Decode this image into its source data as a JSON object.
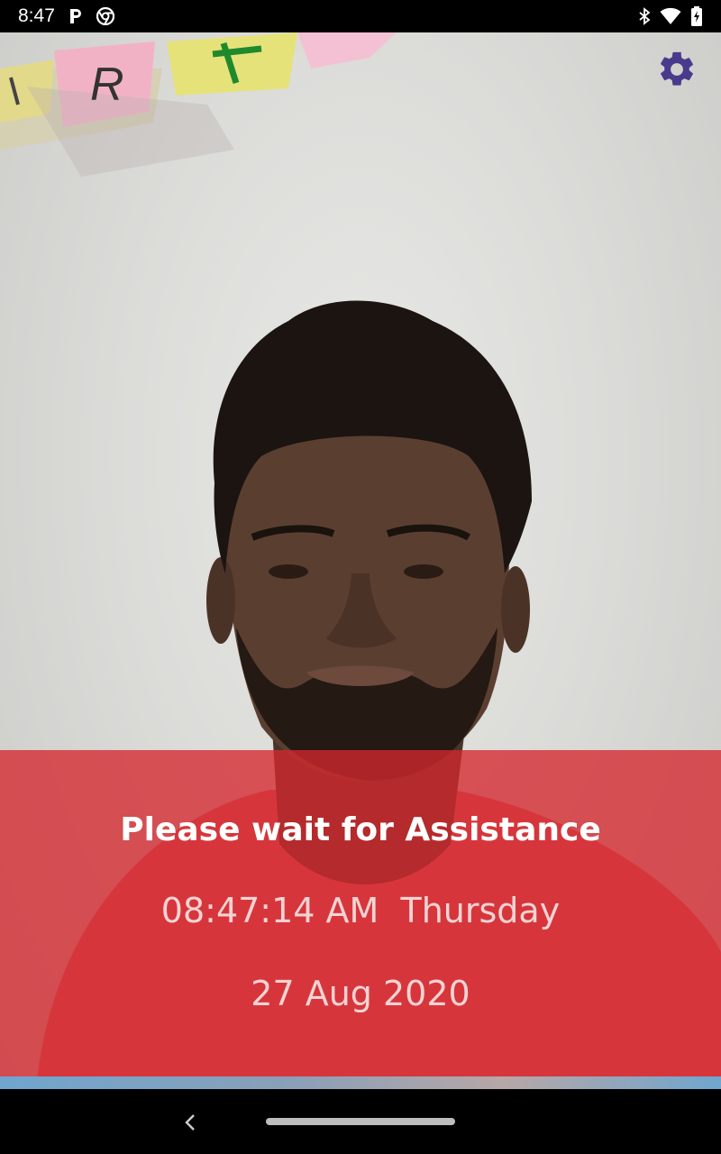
{
  "status_bar": {
    "time": "8:47",
    "left_icons": [
      "parking-p-icon",
      "chrome-icon"
    ],
    "right_icons": [
      "bluetooth-icon",
      "wifi-icon",
      "battery-charging-icon"
    ]
  },
  "camera": {
    "settings_icon": "gear-icon",
    "accent_color": "#4a3a8c"
  },
  "overlay": {
    "message": "Please wait for Assistance",
    "time": "08:47:14 AM",
    "day": "Thursday",
    "date": "27 Aug 2020",
    "color": "#d4282e"
  },
  "nav_bar": {
    "back_icon": "chevron-left-icon",
    "home_icon": "home-pill-icon"
  }
}
